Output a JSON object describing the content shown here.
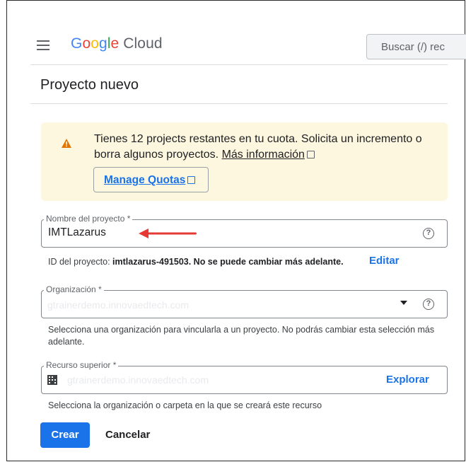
{
  "header": {
    "menu_icon": "hamburger-menu-icon",
    "logo_letters": [
      "G",
      "o",
      "o",
      "g",
      "l",
      "e"
    ],
    "logo_product": "Cloud",
    "search_placeholder": "Buscar (/) rec"
  },
  "page": {
    "title": "Proyecto nuevo"
  },
  "quota_warning": {
    "icon": "warning-triangle-icon",
    "text": "Tienes 12 projects restantes en tu cuota. Solicita un incremento o borra algunos proyectos.",
    "link_label": "Más información",
    "button_label": "Manage Quotas",
    "background_color": "#fef7e0",
    "icon_color": "#e37400"
  },
  "project_name": {
    "label": "Nombre del proyecto *",
    "value": "IMTLazarus",
    "help_icon": "help-circle-icon",
    "annotation": "red-arrow-icon",
    "id_prefix": "ID del proyecto: ",
    "id_value": "imtlazarus-491503. No se puede cambiar más adelante.",
    "edit_label": "Editar"
  },
  "organization": {
    "label": "Organización *",
    "value": "gtrainerdemo.innovaedtech.com",
    "help_icon": "help-circle-icon",
    "hint": "Selecciona una organización para vincularla a un proyecto. No podrás cambiar esta selección más adelante."
  },
  "parent_resource": {
    "label": "Recurso superior *",
    "icon": "building-icon",
    "value": "gtrainerdemo.innovaedtech.com",
    "browse_label": "Explorar",
    "hint": "Selecciona la organización o carpeta en la que se creará este recurso"
  },
  "actions": {
    "create_label": "Crear",
    "cancel_label": "Cancelar",
    "primary_color": "#1a73e8"
  }
}
